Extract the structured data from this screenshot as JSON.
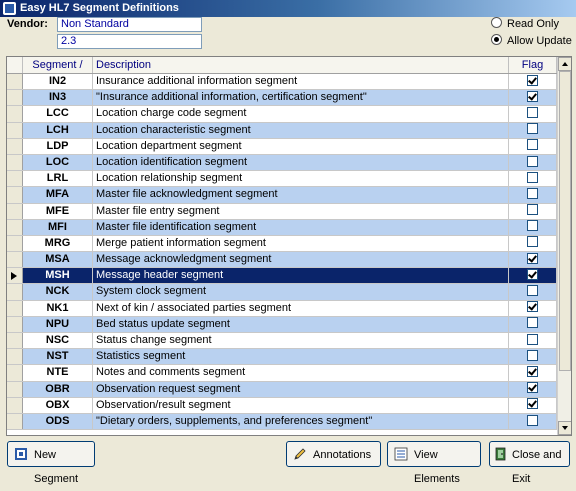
{
  "window": {
    "title": "Easy HL7 Segment Definitions"
  },
  "vendor": {
    "label": "Vendor:",
    "name": "Non Standard",
    "version": "2.3"
  },
  "mode": {
    "options": [
      "Read Only",
      "Allow Update"
    ],
    "selected": "Allow Update"
  },
  "grid": {
    "columns": {
      "segment": "Segment /",
      "description": "Description",
      "flag": "Flag"
    },
    "selected_segment": "MSH",
    "rows": [
      {
        "segment": "IN2",
        "description": "Insurance additional information segment",
        "flag": true
      },
      {
        "segment": "IN3",
        "description": "\"Insurance additional information, certification segment\"",
        "flag": true
      },
      {
        "segment": "LCC",
        "description": "Location charge code segment",
        "flag": false
      },
      {
        "segment": "LCH",
        "description": "Location characteristic segment",
        "flag": false
      },
      {
        "segment": "LDP",
        "description": "Location department segment",
        "flag": false
      },
      {
        "segment": "LOC",
        "description": "Location identification segment",
        "flag": false
      },
      {
        "segment": "LRL",
        "description": "Location relationship segment",
        "flag": false
      },
      {
        "segment": "MFA",
        "description": "Master file acknowledgment segment",
        "flag": false
      },
      {
        "segment": "MFE",
        "description": "Master file entry segment",
        "flag": false
      },
      {
        "segment": "MFI",
        "description": "Master file identification segment",
        "flag": false
      },
      {
        "segment": "MRG",
        "description": "Merge patient information segment",
        "flag": false
      },
      {
        "segment": "MSA",
        "description": "Message acknowledgment segment",
        "flag": true
      },
      {
        "segment": "MSH",
        "description": "Message header segment",
        "flag": true
      },
      {
        "segment": "NCK",
        "description": "System clock segment",
        "flag": false
      },
      {
        "segment": "NK1",
        "description": "Next of kin / associated parties segment",
        "flag": true
      },
      {
        "segment": "NPU",
        "description": "Bed status update segment",
        "flag": false
      },
      {
        "segment": "NSC",
        "description": "Status change segment",
        "flag": false
      },
      {
        "segment": "NST",
        "description": "Statistics segment",
        "flag": false
      },
      {
        "segment": "NTE",
        "description": "Notes and comments segment",
        "flag": true
      },
      {
        "segment": "OBR",
        "description": "Observation request segment",
        "flag": true
      },
      {
        "segment": "OBX",
        "description": "Observation/result segment",
        "flag": true
      },
      {
        "segment": "ODS",
        "description": "\"Dietary orders, supplements, and preferences segment\"",
        "flag": false
      }
    ]
  },
  "buttons": {
    "new_segment": "New Segment",
    "annotations": "Annotations",
    "view_elements": "View Elements",
    "close_and_exit": "Close and Exit"
  },
  "colors": {
    "title_start": "#0a246a",
    "row_alt": "#b9d1f0",
    "selected_row": "#0a246a"
  }
}
